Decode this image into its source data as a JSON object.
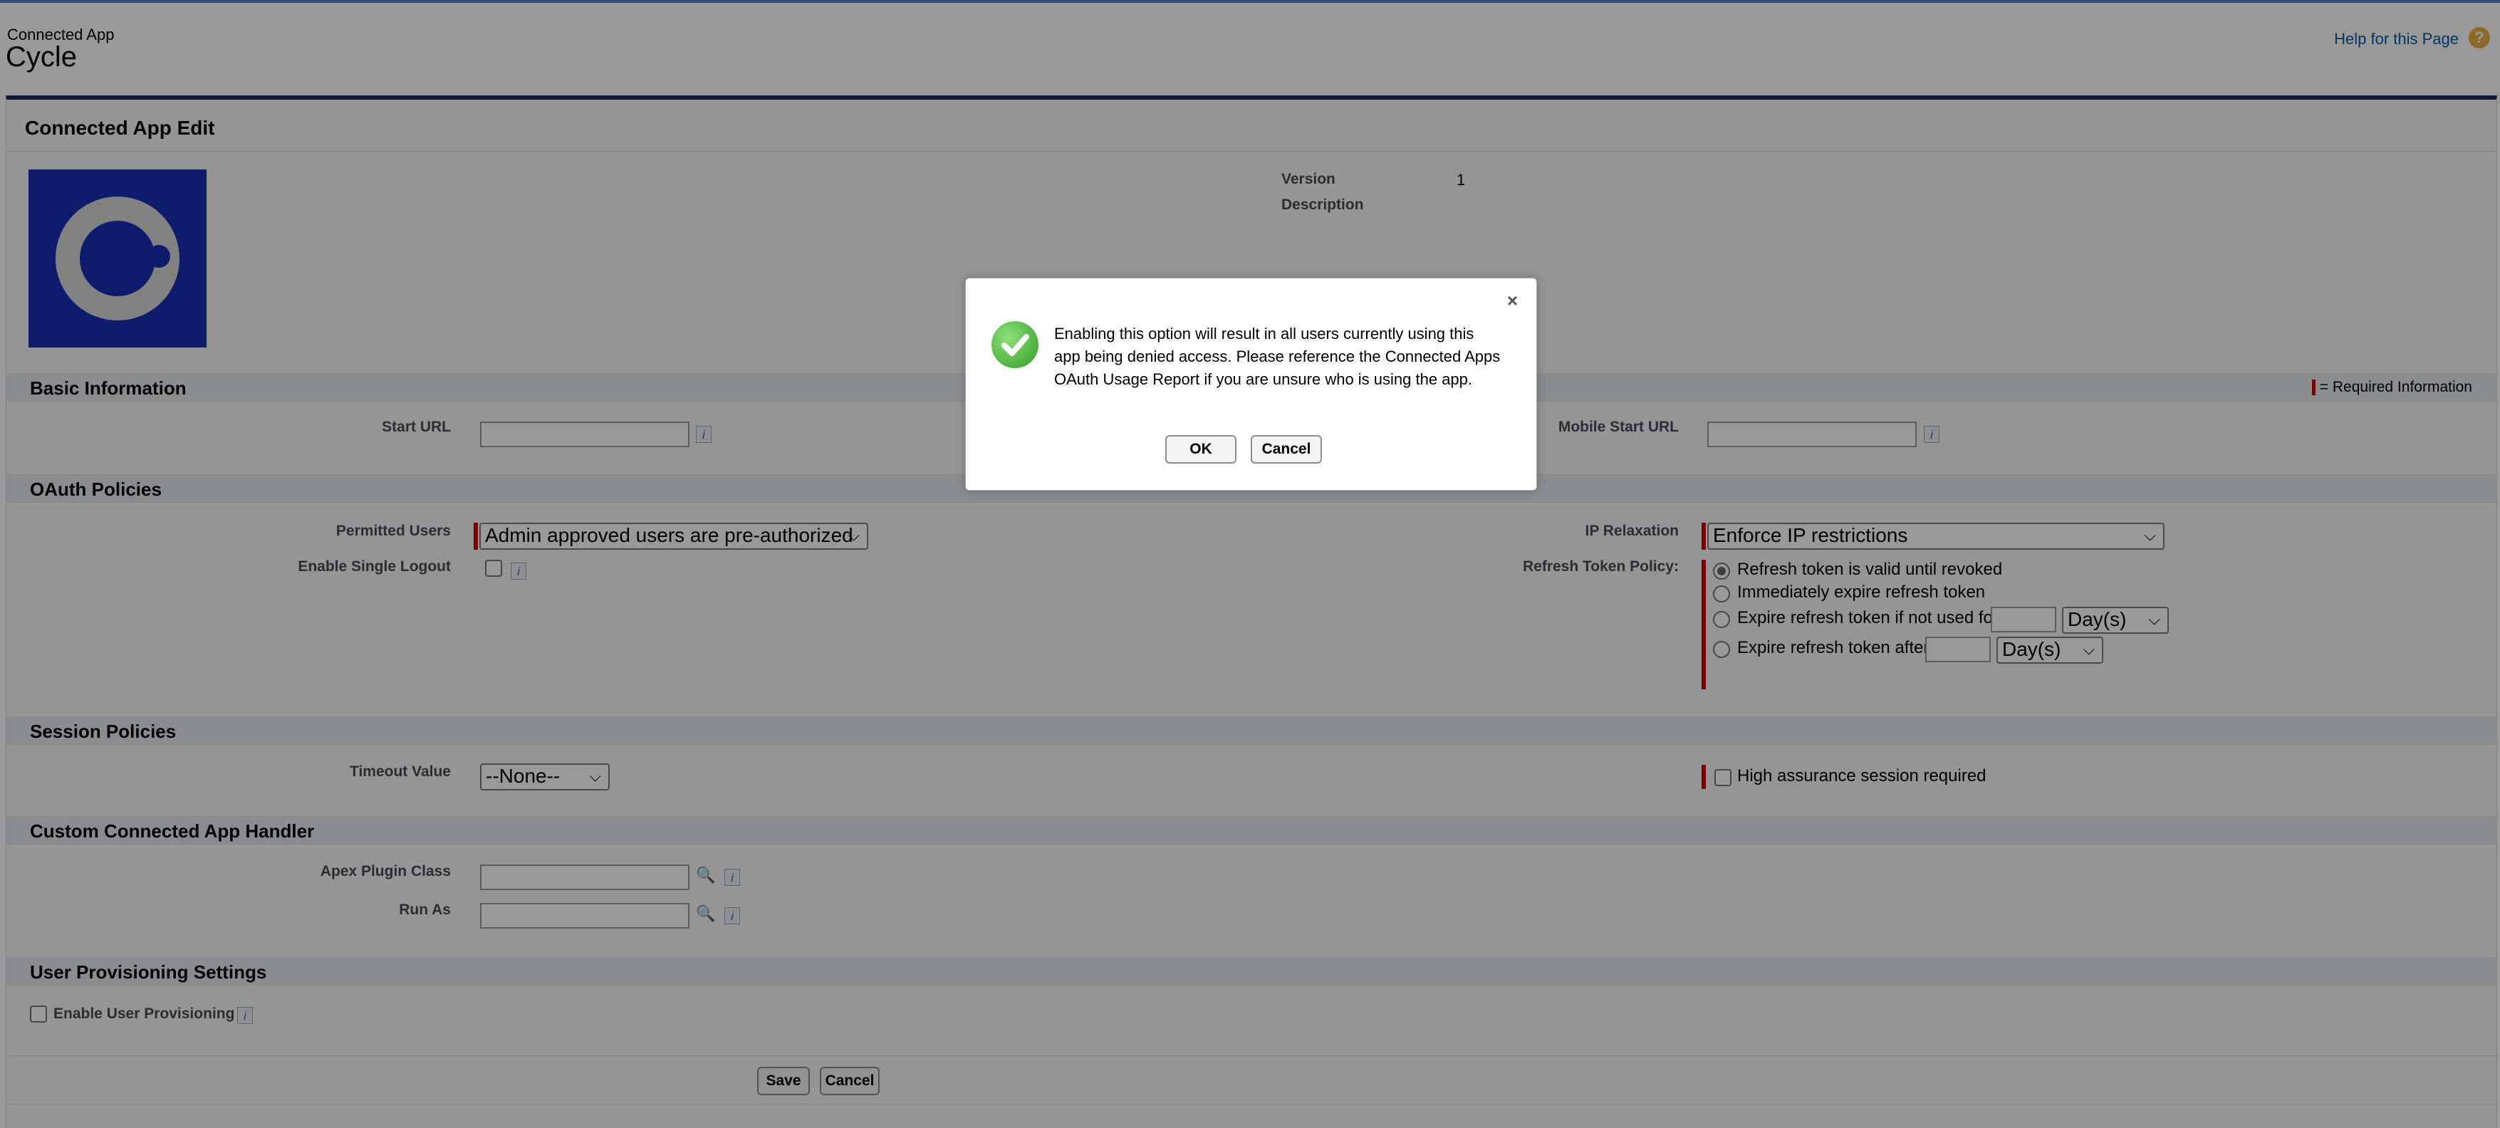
{
  "header": {
    "subtitle": "Connected App",
    "title": "Cycle",
    "help_link": "Help for this Page"
  },
  "edit": {
    "title": "Connected App Edit",
    "version_label": "Version",
    "version_value": "1",
    "description_label": "Description"
  },
  "basic": {
    "title": "Basic Information",
    "required_text": "= Required Information",
    "start_url_label": "Start URL",
    "mobile_start_url_label": "Mobile Start URL"
  },
  "oauth": {
    "title": "OAuth Policies",
    "permitted_users_label": "Permitted Users",
    "permitted_users_value": "Admin approved users are pre-authorized",
    "single_logout_label": "Enable Single Logout",
    "ip_relaxation_label": "IP Relaxation",
    "ip_relaxation_value": "Enforce IP restrictions",
    "refresh_policy_label": "Refresh Token Policy:",
    "refresh_options": [
      "Refresh token is valid until revoked",
      "Immediately expire refresh token",
      "Expire refresh token if not used for",
      "Expire refresh token after"
    ],
    "days_unit": "Day(s)"
  },
  "session": {
    "title": "Session Policies",
    "timeout_label": "Timeout Value",
    "timeout_value": "--None--",
    "high_assurance_label": "High assurance session required"
  },
  "handler": {
    "title": "Custom Connected App Handler",
    "apex_label": "Apex Plugin Class",
    "run_as_label": "Run As"
  },
  "provisioning": {
    "title": "User Provisioning Settings",
    "enable_label": "Enable User Provisioning"
  },
  "footer": {
    "save": "Save",
    "cancel": "Cancel"
  },
  "modal": {
    "message": "Enabling this option will result in all users currently using this app being denied access. Please reference the Connected Apps OAuth Usage Report if you are unsure who is using the app.",
    "ok": "OK",
    "cancel": "Cancel"
  },
  "colors": {
    "required_bar": "#cc0000",
    "logo_bg": "#1a2fb8",
    "panel_border": "#1b2b5d",
    "help_link": "#015ba7"
  }
}
